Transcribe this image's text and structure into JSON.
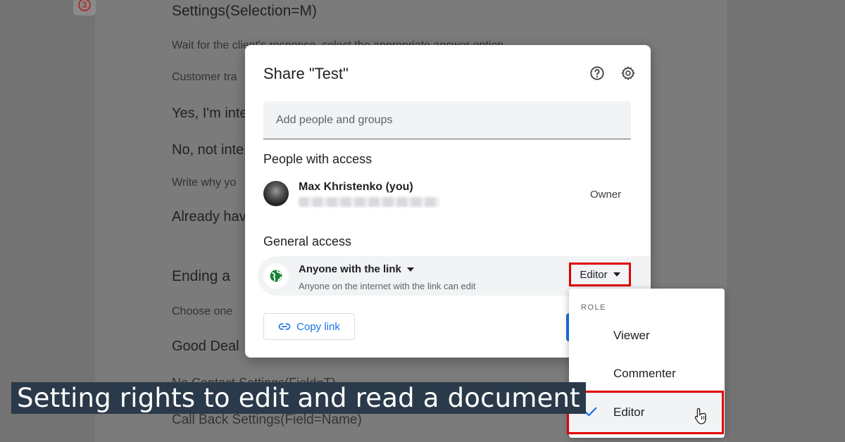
{
  "document": {
    "badge": "3",
    "lines": [
      "Settings(Selection=M)",
      "Wait for the client's response, select the appropriate answer option",
      "Customer tra",
      "Yes, I'm inte",
      "No, not inte",
      "Write why yo",
      "Already hav",
      "Ending a",
      "Choose one",
      "Good Deal",
      "No Contact Settings(Field=T)",
      "Call Back Settings(Field=Name)"
    ]
  },
  "dialog": {
    "title": "Share \"Test\"",
    "help_icon": "help-circle-icon",
    "settings_icon": "gear-icon",
    "add_people_placeholder": "Add people and groups",
    "people_section_title": "People with access",
    "person": {
      "name": "Max Khristenko (you)",
      "role": "Owner"
    },
    "general_access_title": "General access",
    "access": {
      "title": "Anyone with the link",
      "description": "Anyone on the internet with the link can edit",
      "role": "Editor"
    },
    "copy_link_label": "Copy link"
  },
  "role_menu": {
    "header": "ROLE",
    "items": [
      {
        "label": "Viewer",
        "selected": false
      },
      {
        "label": "Commenter",
        "selected": false
      },
      {
        "label": "Editor",
        "selected": true
      }
    ]
  },
  "caption": "Setting rights to edit and read a document",
  "colors": {
    "accent": "#1a73e8",
    "highlight": "#e00000",
    "globe": "#188038"
  }
}
